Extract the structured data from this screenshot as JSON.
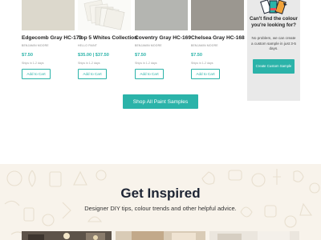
{
  "products": [
    {
      "name": "Edgecomb Gray HC-173",
      "brand": "BENJAMIN MOORE",
      "price": "$7.50",
      "ship": "Ships in 1-2 days",
      "cta": "Add to Cart",
      "color": "#dcd8cc"
    },
    {
      "name": "Top 5 Whites Collection",
      "brand": "HELLO PAINT",
      "price": "$35.00 | $37.50",
      "ship": "Ships in 1-2 days",
      "cta": "Add to Cart",
      "color": "#f1efe7"
    },
    {
      "name": "Coventry Gray HC-169",
      "brand": "BENJAMIN MOORE",
      "price": "$7.50",
      "ship": "Ships in 1-2 days",
      "cta": "Add to Cart",
      "color": "#b4b5b1"
    },
    {
      "name": "Chelsea Gray HC-168",
      "brand": "BENJAMIN MOORE",
      "price": "$7.50",
      "ship": "Ships in 1-2 days",
      "cta": "Add to Cart",
      "color": "#9b9790"
    }
  ],
  "promo": {
    "title": "Can't find the colour you're looking for?",
    "body": "No problem, we can create a custom sample in just 3-5 days.",
    "button": "Create Custom Sample",
    "icon": "paint-swatch-icon"
  },
  "shop_all": "Shop All Paint Samples",
  "inspire": {
    "title": "Get Inspired",
    "subtitle": "Designer DIY tips, colour trends and other helpful advice."
  },
  "colors": {
    "accent": "#2bb3a9",
    "promo_bg": "#e9e9e9",
    "inspire_bg": "#f8f3eb"
  }
}
